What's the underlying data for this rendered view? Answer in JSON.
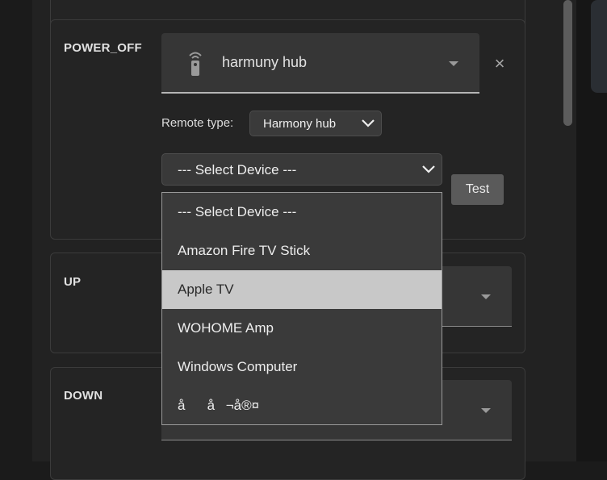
{
  "cards": {
    "power_off": {
      "label": "POWER_OFF",
      "entity_value": "harmuny hub",
      "remote_type_label": "Remote type:",
      "remote_type_value": "Harmony hub",
      "device_select_value": "--- Select Device ---",
      "test_label": "Test"
    },
    "up": {
      "label": "UP"
    },
    "down": {
      "label": "DOWN"
    }
  },
  "dropdown": {
    "options": [
      "--- Select Device ---",
      "Amazon Fire TV Stick",
      "Apple TV",
      "WOHOME Amp",
      "Windows Computer",
      "åå¬å®¤"
    ],
    "highlighted_index": 2
  },
  "icons": {
    "entity": "remote-control-icon",
    "clear": "close-icon",
    "select_caret": "chevron-down-icon"
  },
  "colors": {
    "background": "#1b1b1b",
    "card": "#242424",
    "field": "#363636",
    "highlight": "#c8c8c8"
  }
}
